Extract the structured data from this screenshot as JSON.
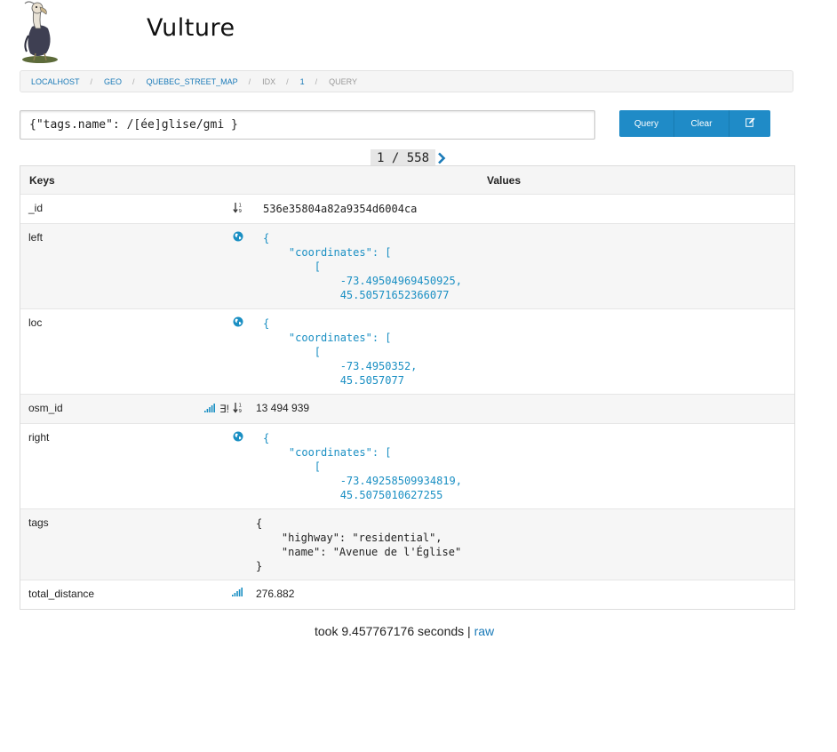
{
  "app": {
    "title": "Vulture"
  },
  "breadcrumb": [
    {
      "label": "localhost",
      "link": true
    },
    {
      "label": "geo",
      "link": true
    },
    {
      "label": "quebec_street_map",
      "link": true
    },
    {
      "label": "idx",
      "link": false
    },
    {
      "label": "1",
      "link": true
    },
    {
      "label": "query",
      "link": false
    }
  ],
  "query": {
    "value": "{\"tags.name\": /[ée]glise/gmi }"
  },
  "buttons": {
    "query": "Query",
    "clear": "Clear",
    "edit_icon": "edit-icon"
  },
  "pager": {
    "current": "1",
    "total": "558",
    "separator": "/"
  },
  "table": {
    "headers": {
      "keys": "Keys",
      "values": "Values"
    },
    "rows": [
      {
        "key": "_id",
        "icons": [
          "sort-numeric-icon"
        ],
        "value": "536e35804a82a9354d6004ca",
        "style": "mono"
      },
      {
        "key": "left",
        "icons": [
          "globe-icon"
        ],
        "value": "{\n    \"coordinates\": [\n        [\n            -73.49504969450925,\n            45.50571652366077",
        "style": "geo"
      },
      {
        "key": "loc",
        "icons": [
          "globe-icon"
        ],
        "value": "{\n    \"coordinates\": [\n        [\n            -73.4950352,\n            45.5057077",
        "style": "geo"
      },
      {
        "key": "osm_id",
        "icons": [
          "signal-icon",
          "exists-icon",
          "sort-numeric-icon"
        ],
        "value": "13 494 939",
        "style": "num"
      },
      {
        "key": "right",
        "icons": [
          "globe-icon"
        ],
        "value": "{\n    \"coordinates\": [\n        [\n            -73.49258509934819,\n            45.5075010627255",
        "style": "geo"
      },
      {
        "key": "tags",
        "icons": [],
        "value": "{\n    \"highway\": \"residential\",\n    \"name\": \"Avenue de l'Église\"\n}",
        "style": "plain"
      },
      {
        "key": "total_distance",
        "icons": [
          "signal-icon"
        ],
        "value": "276.882",
        "style": "num"
      }
    ]
  },
  "footer": {
    "took": "took 9.457767176 seconds |",
    "raw": "raw"
  },
  "colors": {
    "accent": "#1f8bc7",
    "link": "#1a7ab8",
    "geo_text": "#1a8fc3"
  }
}
